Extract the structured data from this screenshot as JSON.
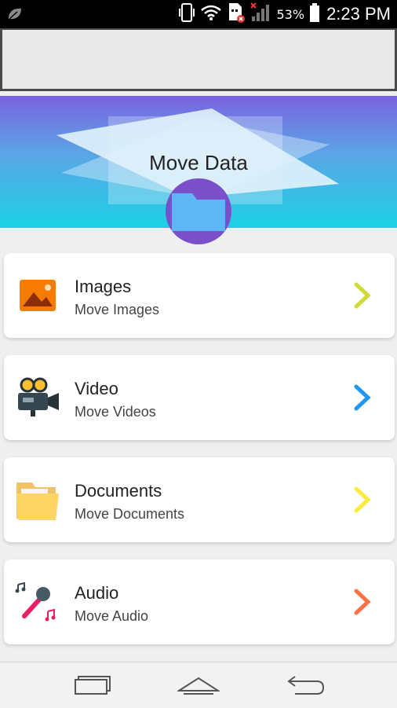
{
  "status_bar": {
    "battery_percent": "53%",
    "time": "2:23 PM"
  },
  "header": {
    "title": "Move Data",
    "gradient_colors": [
      "#7b63e0",
      "#1cd2e5"
    ],
    "badge_color": "#7a4fc9"
  },
  "items": [
    {
      "title": "Images",
      "subtitle": "Move Images",
      "icon": "image-icon",
      "chevron_color": "#cddc39"
    },
    {
      "title": "Video",
      "subtitle": "Move Videos",
      "icon": "video-camera-icon",
      "chevron_color": "#2196f3"
    },
    {
      "title": "Documents",
      "subtitle": "Move Documents",
      "icon": "folder-icon",
      "chevron_color": "#ffeb3b"
    },
    {
      "title": "Audio",
      "subtitle": "Move Audio",
      "icon": "microphone-music-icon",
      "chevron_color": "#ff7043"
    }
  ],
  "nav": {
    "recent": "recent-apps-icon",
    "home": "home-icon",
    "back": "back-icon"
  }
}
